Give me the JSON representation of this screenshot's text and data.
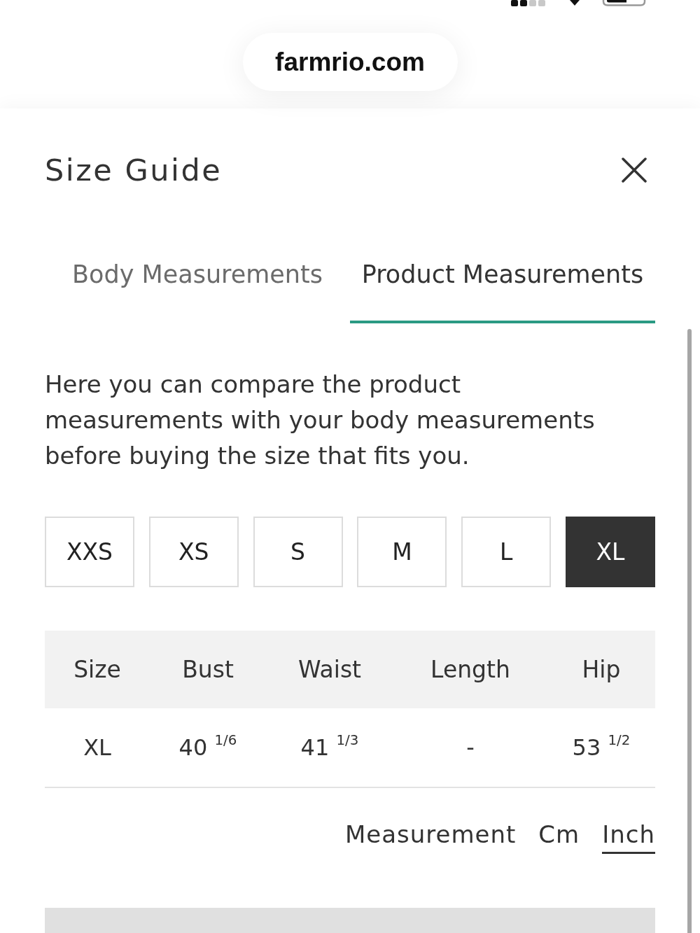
{
  "browser": {
    "url": "farmrio.com"
  },
  "title": "Size Guide",
  "tabs": [
    {
      "label": "Body Measurements",
      "selected": false
    },
    {
      "label": "Product Measurements",
      "selected": true
    }
  ],
  "description": "Here you can compare the product measurements with your body measurements before buying the size that fits you.",
  "sizes": [
    {
      "label": "XXS",
      "selected": false
    },
    {
      "label": "XS",
      "selected": false
    },
    {
      "label": "S",
      "selected": false
    },
    {
      "label": "M",
      "selected": false
    },
    {
      "label": "L",
      "selected": false
    },
    {
      "label": "XL",
      "selected": true
    }
  ],
  "table": {
    "columns": [
      "Size",
      "Bust",
      "Waist",
      "Length",
      "Hip"
    ],
    "rows": [
      [
        "XL",
        "40 $^{1/6}$",
        "41 $^{1/3}$",
        "-",
        "53 $^{1/2}$"
      ]
    ]
  },
  "units": {
    "label": "Measurement",
    "options": [
      {
        "label": "Cm",
        "selected": false
      },
      {
        "label": "Inch",
        "selected": true
      }
    ]
  }
}
